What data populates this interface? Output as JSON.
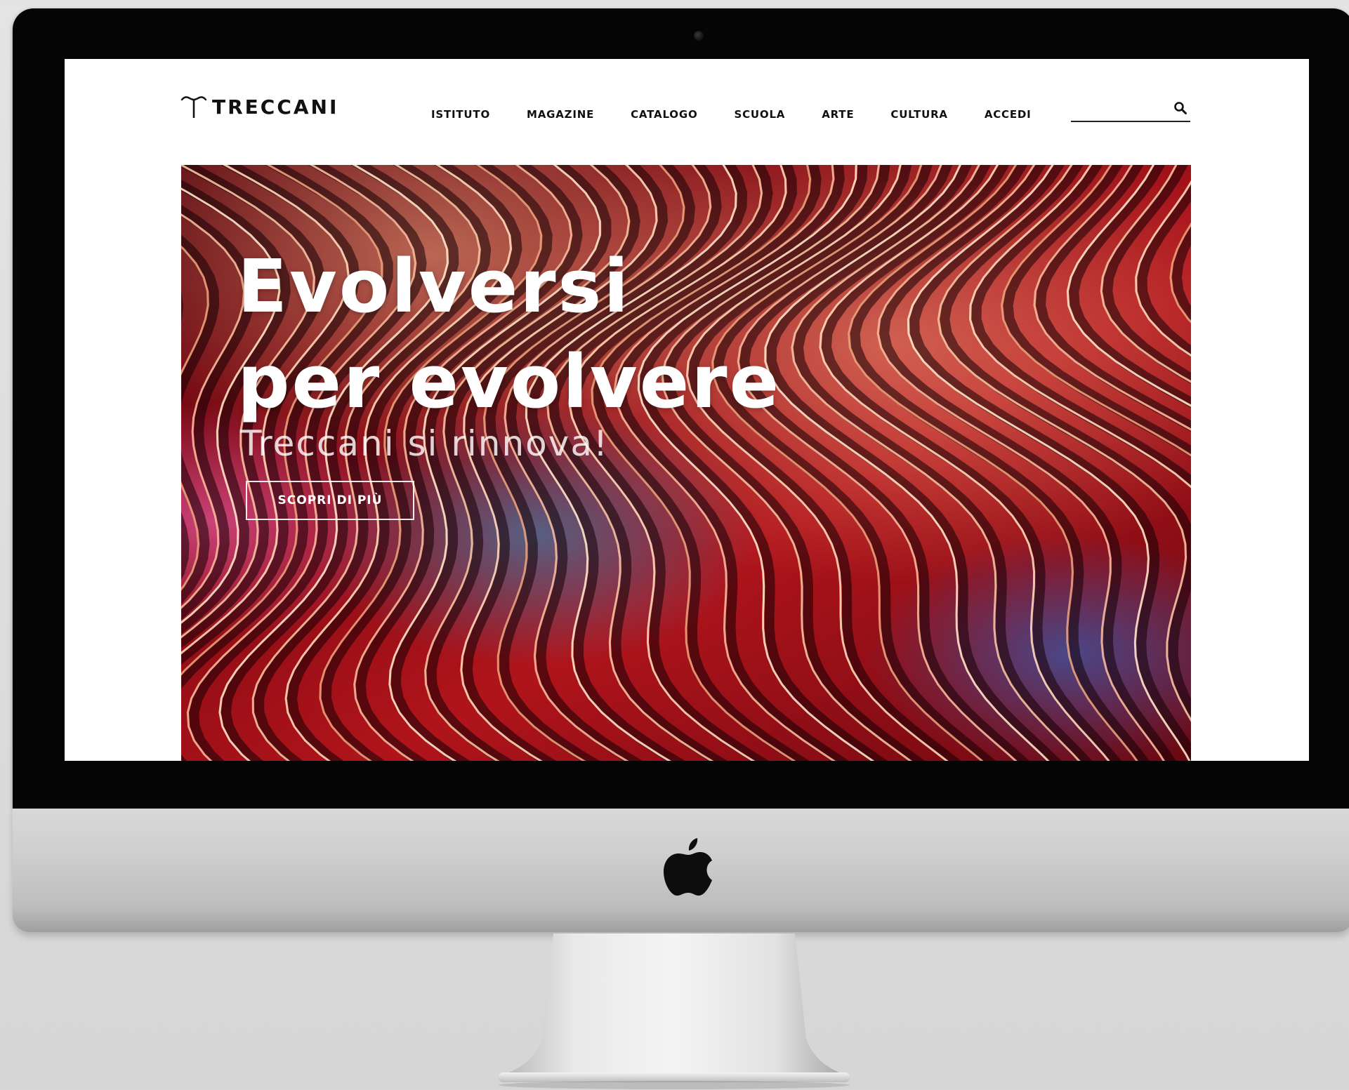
{
  "brand": {
    "name": "TRECCANI",
    "logo_icon": "treccani-t-icon"
  },
  "nav": {
    "items": [
      {
        "label": "ISTITUTO"
      },
      {
        "label": "MAGAZINE"
      },
      {
        "label": "CATALOGO"
      },
      {
        "label": "SCUOLA"
      },
      {
        "label": "ARTE"
      },
      {
        "label": "CULTURA"
      },
      {
        "label": "ACCEDI"
      }
    ]
  },
  "search": {
    "placeholder": "",
    "value": "",
    "icon": "search-icon"
  },
  "hero": {
    "title_line1": "Evolversi",
    "title_line2": "per evolvere",
    "subtitle": "Treccani si rinnova!",
    "cta_label": "SCOPRI DI PIÙ",
    "image": "red-wavy-paper-layers-image"
  },
  "device": {
    "type": "imac-mockup",
    "logo_icon": "apple-logo-icon"
  },
  "colors": {
    "bezel": "#050505",
    "aluminum": "#cfcfcf",
    "page_bg": "#ffffff",
    "nav_text": "#111111",
    "hero_red": "#b3121a",
    "hero_text": "#ffffff"
  }
}
